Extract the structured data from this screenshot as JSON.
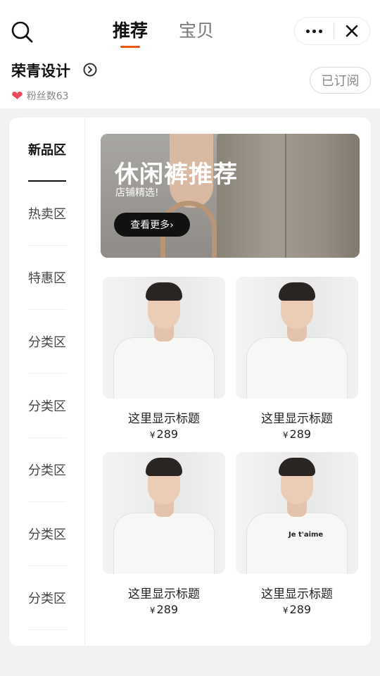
{
  "header": {
    "tabs": [
      {
        "label": "推荐",
        "active": true
      },
      {
        "label": "宝贝",
        "active": false
      }
    ],
    "shop_name": "荣青设计",
    "fans_label": "粉丝数63",
    "subscribe_label": "已订阅"
  },
  "sidebar": {
    "items": [
      {
        "label": "新品区",
        "active": true
      },
      {
        "label": "热卖区"
      },
      {
        "label": "特惠区"
      },
      {
        "label": "分类区"
      },
      {
        "label": "分类区"
      },
      {
        "label": "分类区"
      },
      {
        "label": "分类区"
      },
      {
        "label": "分类区"
      }
    ]
  },
  "banner": {
    "title": "休闲裤推荐",
    "subtitle": "店铺精选!",
    "button_label": "查看更多›"
  },
  "products": [
    {
      "title": "这里显示标题",
      "currency": "¥",
      "price": "289"
    },
    {
      "title": "这里显示标题",
      "currency": "¥",
      "price": "289"
    },
    {
      "title": "这里显示标题",
      "currency": "¥",
      "price": "289"
    },
    {
      "title": "这里显示标题",
      "currency": "¥",
      "price": "289",
      "print_text": "Je t'aime"
    }
  ],
  "colors": {
    "accent": "#e8551a",
    "heart": "#ef4a5c"
  },
  "icons": [
    "search-icon",
    "more-dots-icon",
    "close-icon",
    "circle-arrow-right-icon",
    "heart-icon"
  ]
}
